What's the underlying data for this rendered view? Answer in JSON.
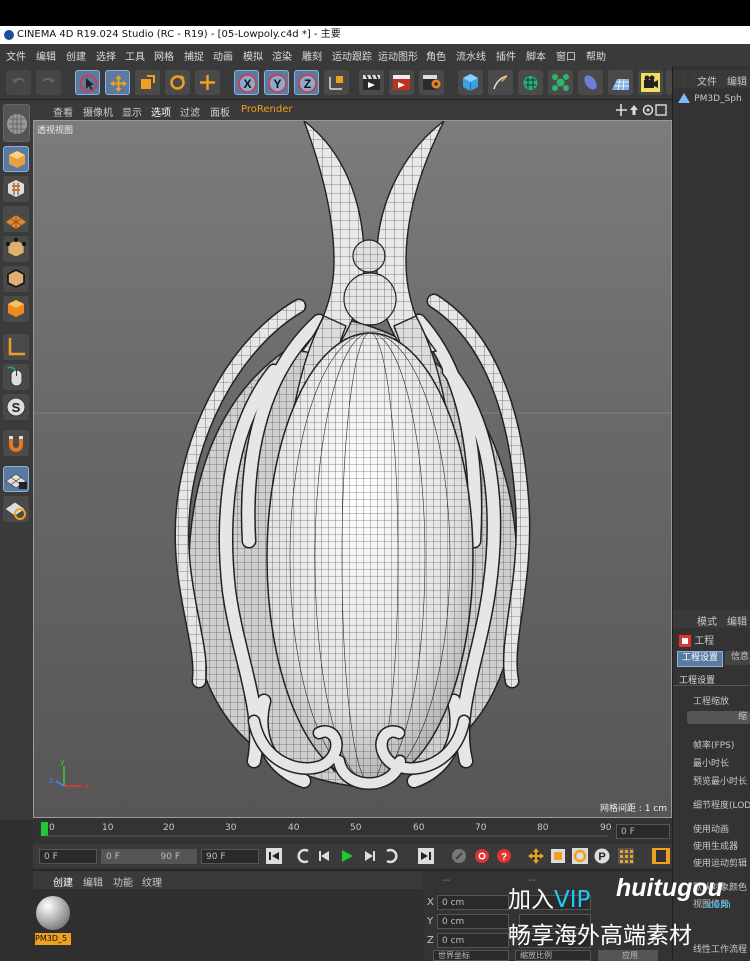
{
  "window": {
    "title": "CINEMA 4D R19.024 Studio (RC - R19) - [05-Lowpoly.c4d *] - 主要"
  },
  "menubar": {
    "items": [
      "文件",
      "编辑",
      "创建",
      "选择",
      "工具",
      "网格",
      "捕捉",
      "动画",
      "模拟",
      "渲染",
      "雕刻",
      "运动跟踪",
      "运动图形",
      "角色",
      "流水线",
      "插件",
      "脚本",
      "窗口",
      "帮助"
    ]
  },
  "toolbar": {
    "axis_labels": [
      "X",
      "Y",
      "Z"
    ]
  },
  "viewport": {
    "menu_items": [
      "查看",
      "摄像机",
      "显示",
      "选项",
      "过滤",
      "面板"
    ],
    "prorender_label": "ProRender",
    "view_name": "透视视图",
    "grid_spacing": "网格间距 : 1 cm",
    "axis_x": "x",
    "axis_y": "y",
    "axis_z": "z"
  },
  "timeline": {
    "ticks": [
      "0",
      "10",
      "20",
      "30",
      "40",
      "50",
      "60",
      "70",
      "80",
      "90"
    ],
    "current_frame": "0 F"
  },
  "playback": {
    "start_field": "0 F",
    "range_start": "0 F",
    "range_end": "90 F",
    "end_field": "90 F"
  },
  "object_manager": {
    "tabs": [
      "文件",
      "编辑"
    ],
    "object_name": "PM3D_Sph"
  },
  "attributes": {
    "tabs": [
      "模式",
      "编辑"
    ],
    "project_label": "工程",
    "subtabs": [
      "工程设置",
      "信息"
    ],
    "section": "工程设置",
    "scale_label": "工程缩放",
    "scale_button": "缩",
    "rows": [
      "帧率(FPS)",
      "最小时长",
      "预览最小时长",
      "细节程度(LOD",
      "使用动画",
      "使用生成器",
      "使用运动剪辑",
      "默认对象颜色",
      "视图修剪",
      "线性工作流程"
    ]
  },
  "material_manager": {
    "tabs": [
      "创建",
      "编辑",
      "功能",
      "纹理"
    ],
    "material_name": "PM3D_5"
  },
  "coordinates": {
    "header_a": "--",
    "header_b": "--",
    "rows": [
      {
        "axis": "X",
        "value": "0 cm"
      },
      {
        "axis": "Y",
        "value": "0 cm"
      },
      {
        "axis": "Z",
        "value": "0 cm"
      }
    ],
    "mode_select": "世界坐标",
    "scale_select": "缩放比例",
    "apply_label": "应用"
  },
  "watermark": {
    "line1_prefix": "加入",
    "line1_vip": "VIP",
    "brand": "huitugou",
    "brand_suffix": ".com",
    "line2": "畅享海外高端素材"
  },
  "colors": {
    "accent_blue": "#5b7aa2",
    "active_green": "#22c833",
    "highlight_orange": "#f0a020"
  }
}
